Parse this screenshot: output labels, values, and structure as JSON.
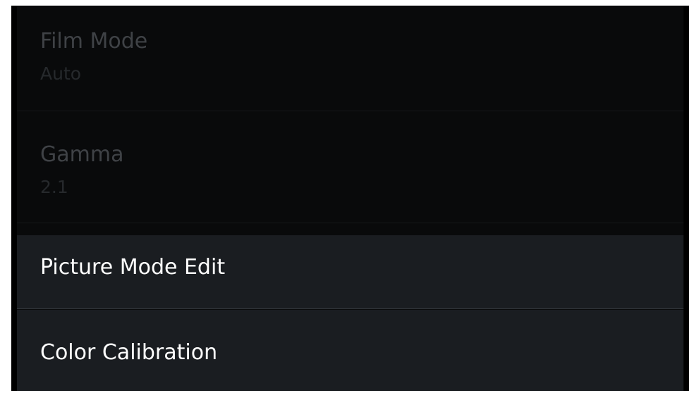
{
  "settings_menu": {
    "items": [
      {
        "label": "Film Mode",
        "value": "Auto",
        "state": "disabled"
      },
      {
        "label": "Gamma",
        "value": "2.1",
        "state": "disabled"
      },
      {
        "label": "Picture Mode Edit",
        "state": "enabled"
      },
      {
        "label": "Color Calibration",
        "state": "enabled"
      }
    ]
  },
  "colors": {
    "panel_background": "#090a0b",
    "active_item_background": "#1a1d21",
    "disabled_text": "#3f4246",
    "active_text": "#ffffff"
  }
}
